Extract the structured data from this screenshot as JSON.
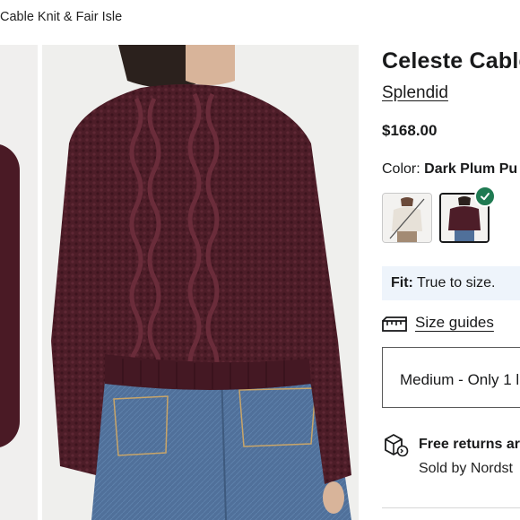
{
  "breadcrumb": "Cable Knit & Fair Isle",
  "product": {
    "title": "Celeste Cable",
    "brand": "Splendid",
    "price": "$168.00",
    "color_label": "Color:",
    "color_value": "Dark Plum Pu",
    "swatches": [
      {
        "name": "Ivory",
        "available": false,
        "selected": false
      },
      {
        "name": "Dark Plum",
        "available": true,
        "selected": true
      }
    ]
  },
  "fit": {
    "label": "Fit:",
    "value": "True to size."
  },
  "size_guides": {
    "label": "Size guides",
    "icon": "ruler-icon"
  },
  "size_select": {
    "value": "Medium - Only 1 l"
  },
  "returns": {
    "line1": "Free returns ar",
    "line2": "Sold by Nordst",
    "icon": "package-return-icon"
  },
  "colors": {
    "sweater": "#4d1d28",
    "jeans": "#4f6d90",
    "selected_check": "#1f7a52",
    "fit_bg": "#eef4fb"
  }
}
